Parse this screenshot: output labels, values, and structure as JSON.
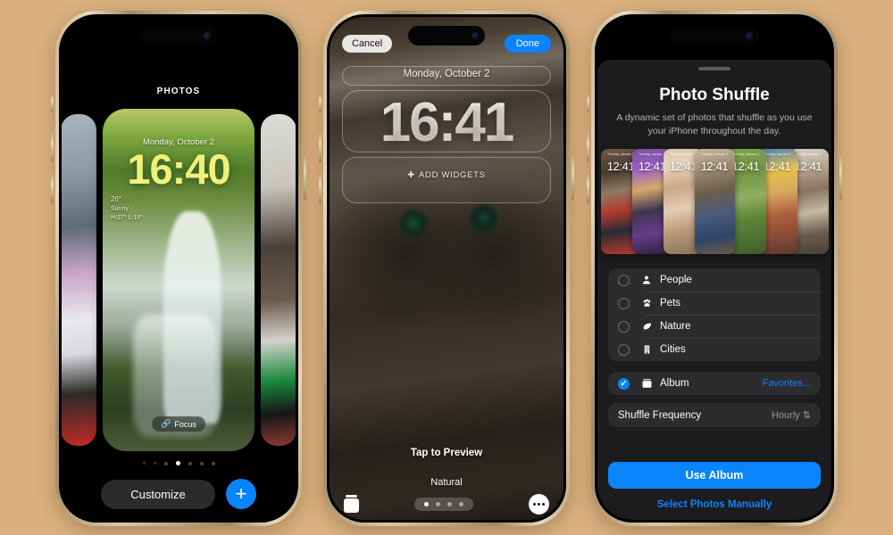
{
  "background_color": "#dbb180",
  "accent_blue": "#0a84ff",
  "phone1": {
    "name": "lock-screen-gallery",
    "header": "PHOTOS",
    "wallpaper": {
      "date": "Monday, October 2",
      "time": "16:40",
      "weather_temp": "26°",
      "weather_cond": "Sunny",
      "weather_hilo": "H:27° L:18°",
      "focus_label": "Focus",
      "focus_icon": "link-icon"
    },
    "page_dots": {
      "count": 7,
      "active_index": 3
    },
    "customize_label": "Customize",
    "add_label": "+",
    "add_icon": "plus-icon"
  },
  "phone2": {
    "name": "lock-screen-editor",
    "cancel_label": "Cancel",
    "done_label": "Done",
    "date": "Monday, October 2",
    "time": "16:41",
    "add_widgets_label": "ADD WIDGETS",
    "add_widgets_icon": "plus-circle-icon",
    "tap_to_preview": "Tap to Preview",
    "style_label": "Natural",
    "stack_icon": "photo-stack-icon",
    "more_icon": "ellipsis-icon",
    "page_dots": {
      "count": 4,
      "active_index": 0
    }
  },
  "phone3": {
    "name": "photo-shuffle-sheet",
    "title": "Photo Shuffle",
    "subtitle": "A dynamic set of photos that shuffle as you use your iPhone throughout the day.",
    "preview_cards": [
      {
        "time": "12:41",
        "date": "Tuesday, January 3",
        "grad": "linear-gradient(170deg,#6d5a4a 0%,#4a3a2c 22%,#8f7a62 40%,#b03a2e 58%,#2b2b33 76%,#c23a30 100%)"
      },
      {
        "time": "12:41",
        "date": "Tuesday, January 3",
        "grad": "linear-gradient(170deg,#7a4f9e 0%,#9c62c4 20%,#d9a86a 38%,#3c3550 58%,#6a3d8c 78%,#2a2236 100%)"
      },
      {
        "time": "12:41",
        "date": "Tuesday, January 3",
        "grad": "linear-gradient(170deg,#d8c8b0 0%,#e8d4bc 18%,#c9a888 36%,#e2cdb4 56%,#b99a78 76%,#8a7258 100%)"
      },
      {
        "time": "12:41",
        "date": "Tuesday, January 3",
        "grad": "linear-gradient(170deg,#c9b89c 0%,#9c8a72 20%,#6b5c4c 42%,#4a5b7e 62%,#2f4468 82%,#6a5a46 100%)"
      },
      {
        "time": "12:41",
        "date": "Tuesday, January 3",
        "grad": "linear-gradient(170deg,#7fa34e 0%,#6e9442 24%,#8fb060 46%,#5e8438 66%,#4c7030 86%,#3c5c26 100%)"
      },
      {
        "time": "12:41",
        "date": "Tuesday, January 3",
        "grad": "linear-gradient(170deg,#4a7ec0 0%,#e8c24a 22%,#d8a860 42%,#b0603c 62%,#8a4a38 82%,#5c3a2c 100%)"
      },
      {
        "time": "12:41",
        "date": "Tuesday, January 3",
        "grad": "linear-gradient(170deg,#d8d2c8 0%,#b8a894 20%,#8a7260 40%,#c4b8a4 60%,#6a5c4a 80%,#4a4038 100%)"
      }
    ],
    "options": [
      {
        "label": "People",
        "icon": "person-icon",
        "glyph": "὆4",
        "checked": false
      },
      {
        "label": "Pets",
        "icon": "paw-icon",
        "glyph": "paw",
        "checked": false
      },
      {
        "label": "Nature",
        "icon": "leaf-icon",
        "glyph": "leaf",
        "checked": false
      },
      {
        "label": "Cities",
        "icon": "building-icon",
        "glyph": "building",
        "checked": false
      }
    ],
    "album_option": {
      "label": "Album",
      "icon": "album-icon",
      "checked": true,
      "value": "Favorites..."
    },
    "shuffle_frequency": {
      "label": "Shuffle Frequency",
      "value": "Hourly",
      "icon": "chevron-updown-icon"
    },
    "primary_button": "Use Album",
    "secondary_link": "Select Photos Manually"
  }
}
